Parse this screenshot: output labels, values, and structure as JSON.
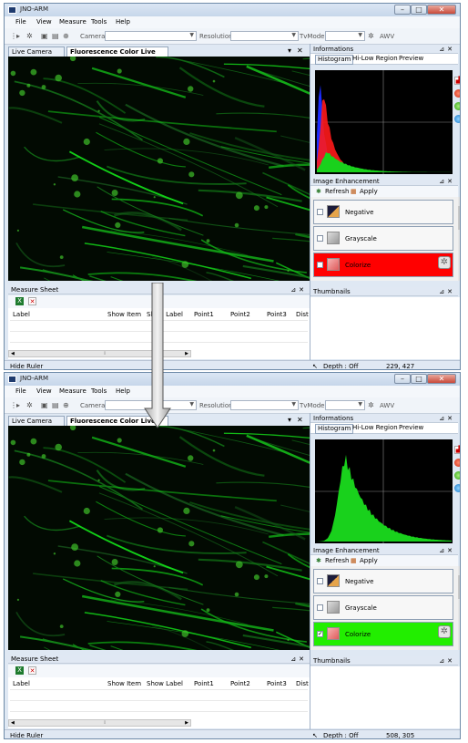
{
  "windows": [
    {
      "title": "JNO-ARM",
      "menu": [
        "File",
        "View",
        "Measure",
        "Tools",
        "Help"
      ],
      "toolbar": {
        "camera_label": "Camera",
        "resolution_label": "Resolution",
        "tvmode_label": "TvMode",
        "awv_label": "AWV"
      },
      "tabs": {
        "live_camera": "Live Camera",
        "fluorescence": "Fluorescence Color Live ..."
      },
      "info": {
        "header": "Informations",
        "tabs": [
          "Histogram",
          "Hi-Low Region",
          "Preview"
        ],
        "histogram_mode": "rgb"
      },
      "enhancement": {
        "header": "Image Enhancement",
        "refresh": "Refresh",
        "apply": "Apply",
        "items": [
          {
            "label": "Negative",
            "checked": false
          },
          {
            "label": "Grayscale",
            "checked": false
          },
          {
            "label": "Colorize",
            "checked": false,
            "color": "#ff0000"
          }
        ]
      },
      "thumbnails_header": "Thumbnails",
      "measure": {
        "header": "Measure Sheet",
        "columns": [
          "Label",
          "Show Item",
          "Show Label",
          "Point1",
          "Point2",
          "Point3",
          "Dist"
        ]
      },
      "status": {
        "hide_ruler": "Hide Ruler",
        "depth": "Depth : Off",
        "coords": "229, 427"
      }
    },
    {
      "title": "JNO-ARM",
      "menu": [
        "File",
        "View",
        "Measure",
        "Tools",
        "Help"
      ],
      "toolbar": {
        "camera_label": "Camera",
        "resolution_label": "Resolution",
        "tvmode_label": "TvMode",
        "awv_label": "AWV"
      },
      "tabs": {
        "live_camera": "Live Camera",
        "fluorescence": "Fluorescence Color Live ..."
      },
      "info": {
        "header": "Informations",
        "tabs": [
          "Histogram",
          "Hi-Low Region",
          "Preview"
        ],
        "histogram_mode": "green"
      },
      "enhancement": {
        "header": "Image Enhancement",
        "refresh": "Refresh",
        "apply": "Apply",
        "items": [
          {
            "label": "Negative",
            "checked": false
          },
          {
            "label": "Grayscale",
            "checked": false
          },
          {
            "label": "Colorize",
            "checked": true,
            "color": "#22ee00"
          }
        ]
      },
      "thumbnails_header": "Thumbnails",
      "measure": {
        "header": "Measure Sheet",
        "columns": [
          "Label",
          "Show Item",
          "Show Label",
          "Point1",
          "Point2",
          "Point3",
          "Dist"
        ]
      },
      "status": {
        "hide_ruler": "Hide Ruler",
        "depth": "Depth : Off",
        "coords": "508, 305"
      }
    }
  ],
  "icons": {
    "app": "app-icon",
    "play": "play-icon",
    "settings": "gear-icon",
    "capture": "camera-icon",
    "crosshair": "crosshair-icon",
    "excel": "excel-icon",
    "delete": "delete-icon",
    "pointer": "pointer-icon",
    "red_channel": "red-channel-icon",
    "green_channel": "green-channel-icon",
    "blue_channel": "blue-channel-icon"
  }
}
